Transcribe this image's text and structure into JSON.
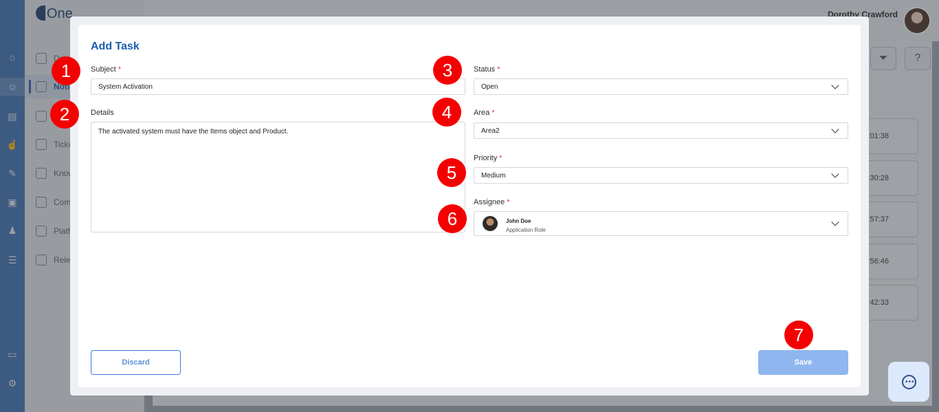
{
  "background": {
    "logo_text": "One",
    "sidebar_items": [
      {
        "label": "Da",
        "active": false
      },
      {
        "label": "Noti",
        "active": true
      },
      {
        "label": "",
        "active": false
      },
      {
        "label": "Ticke",
        "active": false
      },
      {
        "label": "Know",
        "active": false
      },
      {
        "label": "Comr",
        "active": false
      },
      {
        "label": "Platf",
        "active": false
      },
      {
        "label": "Relea",
        "active": false
      }
    ],
    "user_name": "Dorothy Crawford",
    "time_cards": [
      ":01:38",
      ":30:28",
      ":57:37",
      ":56:46",
      ":42:33"
    ],
    "icons": {
      "filter": "filter-icon",
      "help": "help-icon",
      "chat": "chat-icon"
    }
  },
  "modal": {
    "title": "Add Task",
    "subject": {
      "label": "Subject",
      "value": "System Activation",
      "required": "*"
    },
    "details": {
      "label": "Details",
      "value": "The activated system must have the Items object and Product."
    },
    "status": {
      "label": "Status",
      "value": "Open",
      "required": "*"
    },
    "area": {
      "label": "Area",
      "value": "Area2",
      "required": "*"
    },
    "priority": {
      "label": "Priority",
      "value": "Medium",
      "required": "*"
    },
    "assignee": {
      "label": "Assignee",
      "name": "John Doe",
      "role": "Application Role",
      "required": "*"
    },
    "discard_label": "Discard",
    "save_label": "Save"
  },
  "markers": [
    "1",
    "2",
    "3",
    "4",
    "5",
    "6",
    "7"
  ],
  "colors": {
    "accent": "#1b5fae",
    "marker": "#f40000",
    "save_disabled": "#8fb6ef",
    "required": "#d23a3a"
  }
}
